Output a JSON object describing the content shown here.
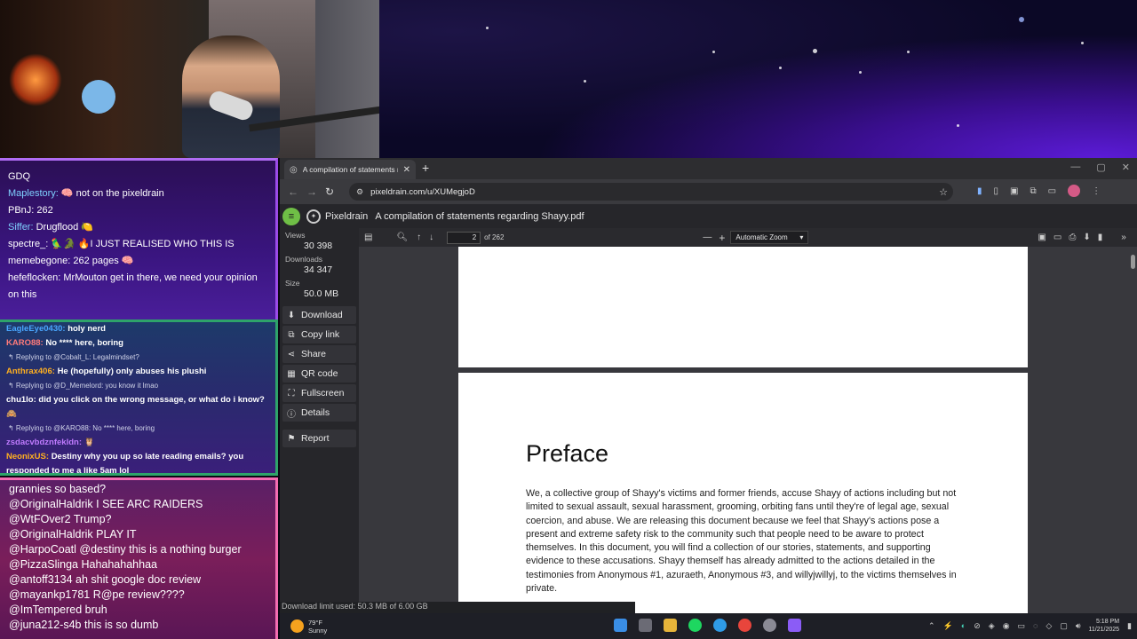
{
  "stream": {
    "chat1": [
      {
        "user": "GDQ",
        "text": "",
        "user_color": "#ffffff"
      },
      {
        "user": "Maplestory:",
        "text": "🧠 not on the pixeldrain",
        "user_color": "#7fd1ff"
      },
      {
        "user": "PBnJ:",
        "text": "262",
        "user_color": "#ffffff"
      },
      {
        "user": "Siffer:",
        "text": "Drugflood 🍋",
        "user_color": "#7fd1ff"
      },
      {
        "user": "spectre_:",
        "text": "🦜🐊 🔥I JUST REALISED WHO THIS IS",
        "user_color": "#ffffff"
      },
      {
        "user": "memebegone:",
        "text": "262 pages 🧠",
        "user_color": "#ffffff"
      },
      {
        "user": "hefeflocken:",
        "text": "MrMouton get in there, we need your opinion",
        "user_color": "#ffffff"
      },
      {
        "user": "",
        "text": "on this",
        "user_color": "#ffffff"
      }
    ],
    "chat2": [
      {
        "type": "msg",
        "user": "EagleEye0430:",
        "user_color": "#4aa6ff",
        "text": "holy nerd"
      },
      {
        "type": "msg",
        "user": "KARO88:",
        "user_color": "#ff7a7a",
        "text": "No **** here, boring"
      },
      {
        "type": "reply",
        "text": "↰ Replying to @Cobalt_L: Legalmindset?"
      },
      {
        "type": "msg",
        "user": "Anthrax406:",
        "user_color": "#ffb020",
        "text": "He (hopefully) only abuses his plushi"
      },
      {
        "type": "reply",
        "text": "↰ Replying to @D_Memelord: you know it lmao"
      },
      {
        "type": "msg",
        "user": "chu1lo:",
        "user_color": "#ffffff",
        "text": "did you click on the wrong message, or what do i know?"
      },
      {
        "type": "msg",
        "user": "",
        "user_color": "#ffffff",
        "text": "🙈"
      },
      {
        "type": "reply",
        "text": "↰ Replying to @KARO88: No **** here, boring"
      },
      {
        "type": "msg",
        "user": "zsdacvbdznfekldn:",
        "user_color": "#c07bff",
        "text": "🦉"
      },
      {
        "type": "msg",
        "user": "NeonixUS:",
        "user_color": "#ffb020",
        "text": "Destiny why you up so late reading emails? you"
      },
      {
        "type": "msg",
        "user": "",
        "user_color": "#ffffff",
        "text": "responded to me a like 5am lol"
      }
    ],
    "chat3": [
      "grannies so based?",
      "@OriginalHaldrik I SEE ARC RAIDERS",
      "@WtFOver2 Trump?",
      "@OriginalHaldrik PLAY IT",
      "@HarpoCoatl @destiny this is a nothing burger",
      "@PizzaSlinga Hahahahahhaa",
      "@antoff3134 ah shit google doc review",
      "@mayankp1781 R@pe review????",
      "@ImTempered bruh",
      "@juna212-s4b this is so dumb"
    ]
  },
  "browser": {
    "tab_title": "A compilation of statements re",
    "url": "pixeldrain.com/u/XUMegjoD",
    "site_name": "Pixeldrain",
    "file_title": "A compilation of statements regarding Shayy.pdf"
  },
  "sidebar": {
    "views_label": "Views",
    "views_value": "30 398",
    "downloads_label": "Downloads",
    "downloads_value": "34 347",
    "size_label": "Size",
    "size_value": "50.0 MB",
    "buttons": [
      "Download",
      "Copy link",
      "Share",
      "QR code",
      "Fullscreen",
      "Details",
      "Report"
    ]
  },
  "pdf": {
    "page_current": "2",
    "page_total": "of 262",
    "zoom": "Automatic Zoom",
    "heading": "Preface",
    "paragraph": "We, a collective group of Shayy's victims and former friends, accuse Shayy of actions including but not limited to sexual assault, sexual harassment, grooming, orbiting fans until they're of legal age, sexual coercion, and abuse. We are releasing this document because we feel that Shayy's actions pose a present and extreme safety risk to the community such that people need to be aware to protect themselves. In this document, you will find a collection of our stories, statements, and supporting evidence to these accusations. Shayy themself has already admitted to the actions detailed in the testimonies from Anonymous #1, azuraeth, Anonymous #3, and willyjwillyj, to the victims themselves in private."
  },
  "status_text": "Download limit used: 50.3 MB of 6.00 GB",
  "taskbar": {
    "temp": "79°F",
    "weather": "Sunny",
    "time": "5:18 PM",
    "date": "11/21/2025"
  }
}
